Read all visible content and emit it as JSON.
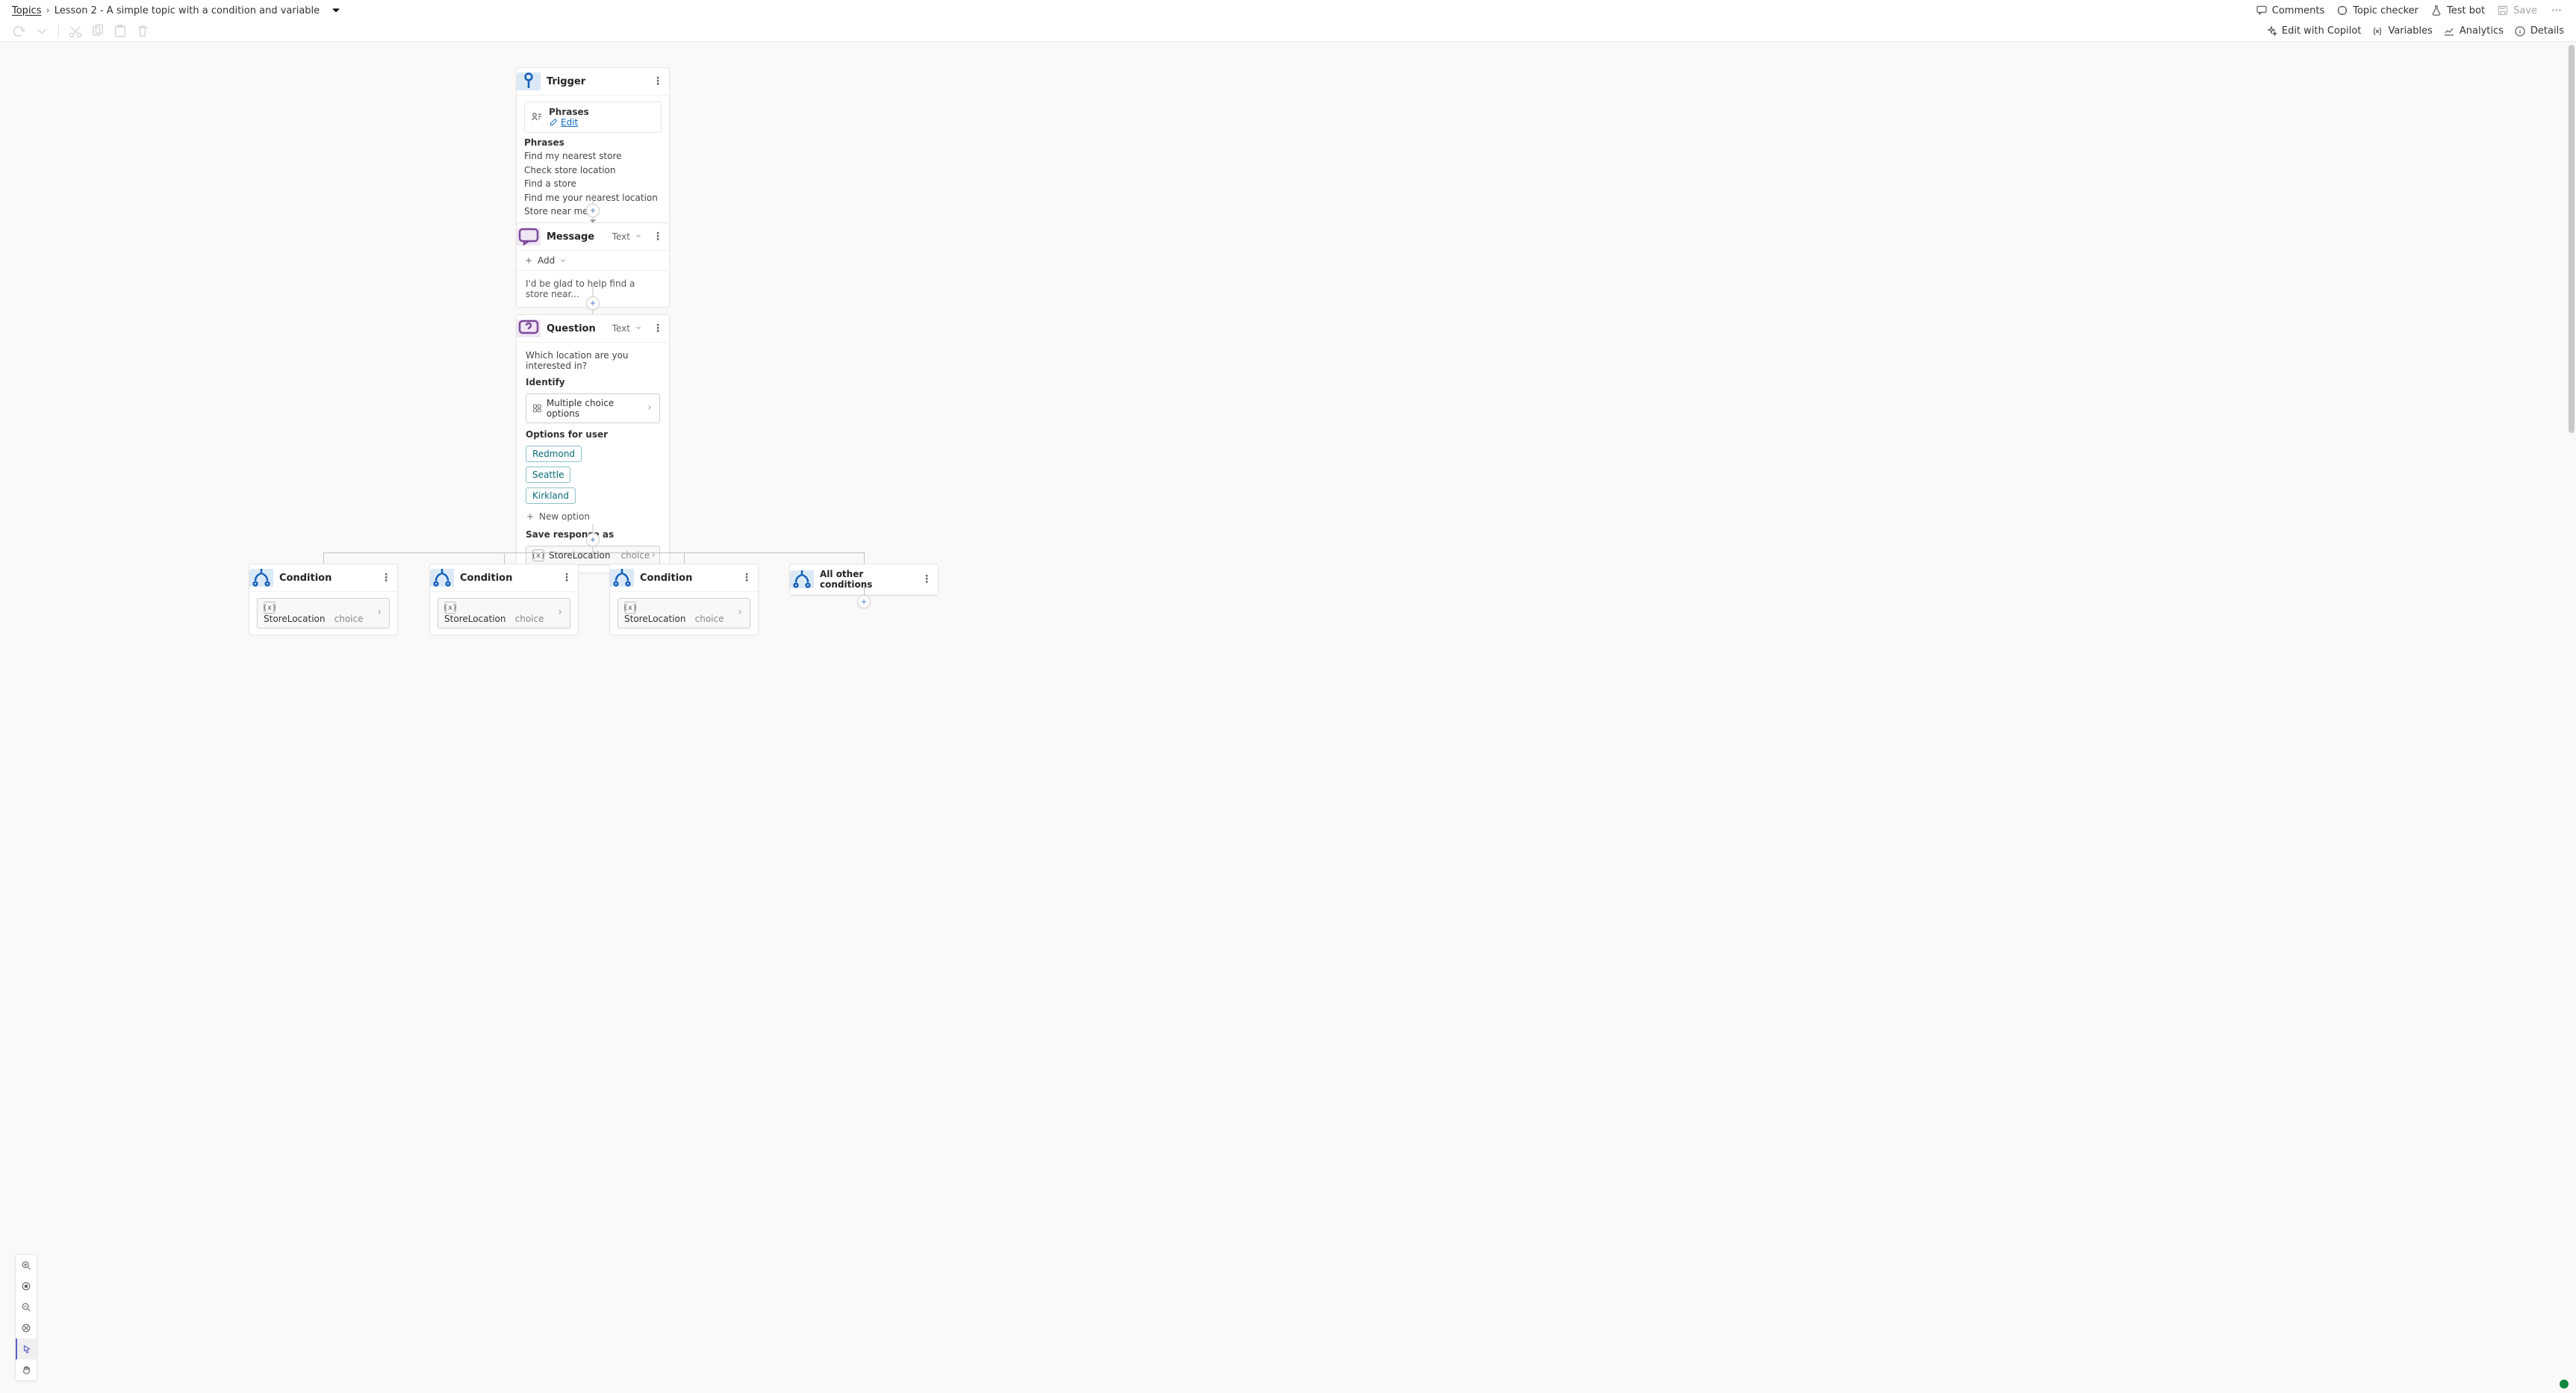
{
  "breadcrumb": {
    "root": "Topics",
    "name": "Lesson 2 - A simple topic with a condition and variable"
  },
  "topbar": {
    "comments": "Comments",
    "topic_checker": "Topic checker",
    "test_bot": "Test bot",
    "save": "Save"
  },
  "toolbar2": {
    "edit_copilot": "Edit with Copilot",
    "variables": "Variables",
    "analytics": "Analytics",
    "details": "Details"
  },
  "trigger": {
    "title": "Trigger",
    "phrases_card_title": "Phrases",
    "edit": "Edit",
    "phrases_heading": "Phrases",
    "phrases": [
      "Find my nearest store",
      "Check store location",
      "Find a store",
      "Find me your nearest location",
      "Store near me"
    ]
  },
  "message": {
    "title": "Message",
    "variant": "Text",
    "add": "Add",
    "content": "I'd be glad to help find a store near..."
  },
  "question": {
    "title": "Question",
    "variant": "Text",
    "prompt": "Which location are you interested in?",
    "identify_label": "Identify",
    "identify_value": "Multiple choice options",
    "options_label": "Options for user",
    "options": [
      "Redmond",
      "Seattle",
      "Kirkland"
    ],
    "new_option": "New option",
    "save_response_label": "Save response as",
    "variable_name": "StoreLocation",
    "variable_type": "choice"
  },
  "conditions": {
    "label": "Condition",
    "other_label": "All other conditions",
    "variable_name": "StoreLocation",
    "variable_type": "choice"
  }
}
